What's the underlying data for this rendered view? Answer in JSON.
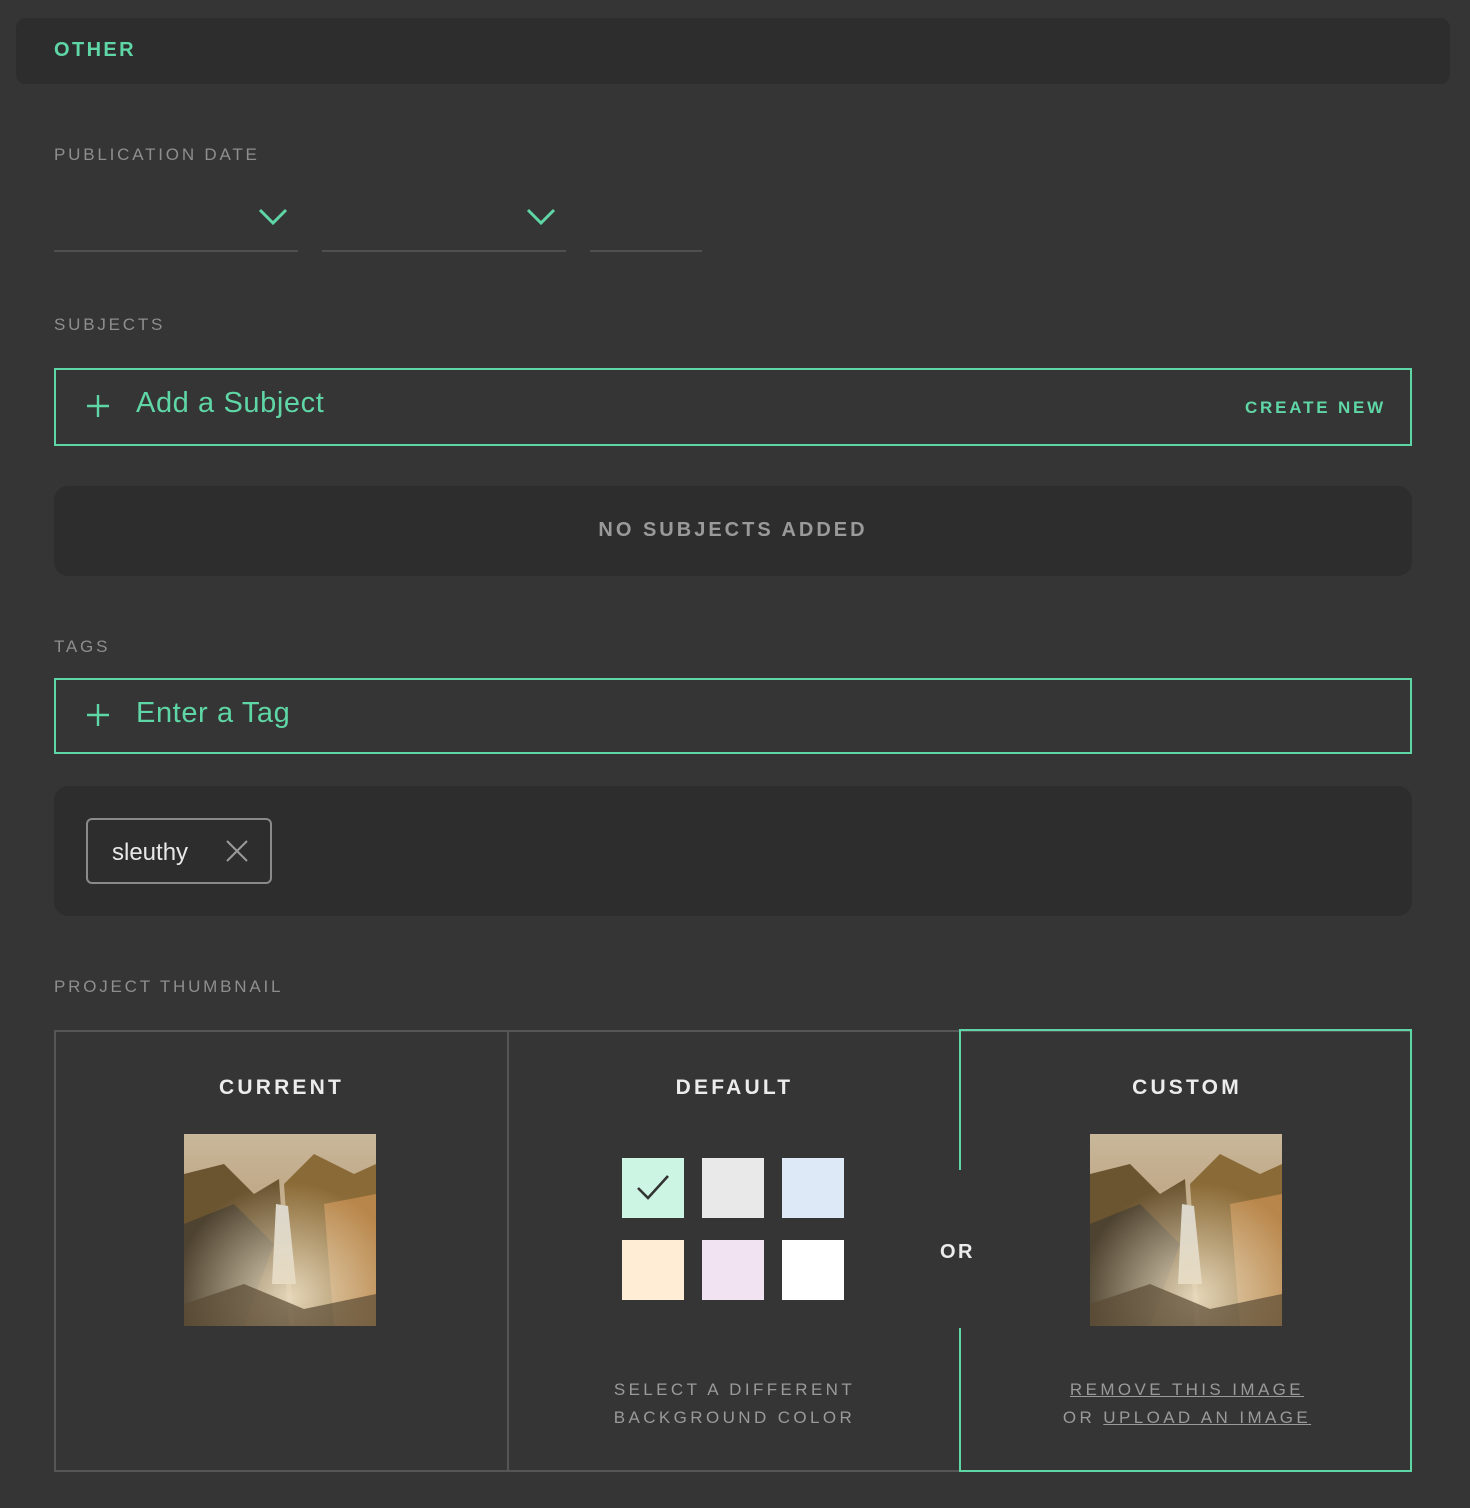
{
  "section": {
    "title": "OTHER"
  },
  "publication_date": {
    "label": "PUBLICATION DATE",
    "month": "",
    "day": "",
    "year": ""
  },
  "subjects": {
    "label": "SUBJECTS",
    "placeholder": "Add a Subject",
    "create_label": "CREATE NEW",
    "empty_message": "NO SUBJECTS ADDED"
  },
  "tags": {
    "label": "TAGS",
    "placeholder": "Enter a Tag",
    "items": [
      {
        "label": "sleuthy"
      }
    ]
  },
  "thumbnail": {
    "label": "PROJECT THUMBNAIL",
    "current": {
      "title": "CURRENT"
    },
    "default": {
      "title": "DEFAULT",
      "swatches": [
        {
          "color": "#cdf5e4",
          "selected": true
        },
        {
          "color": "#e9e9e9",
          "selected": false
        },
        {
          "color": "#dde9f7",
          "selected": false
        },
        {
          "color": "#ffedd5",
          "selected": false
        },
        {
          "color": "#f2e3f2",
          "selected": false
        },
        {
          "color": "#ffffff",
          "selected": false
        }
      ],
      "hint_line1": "SELECT A DIFFERENT",
      "hint_line2": "BACKGROUND COLOR"
    },
    "or_label": "OR",
    "custom": {
      "title": "CUSTOM",
      "remove_link": "REMOVE THIS IMAGE",
      "or_prefix": "OR",
      "upload_link": "UPLOAD AN IMAGE"
    }
  },
  "colors": {
    "accent": "#5fd6a6",
    "background": "#353535",
    "panel": "#2d2d2d"
  }
}
